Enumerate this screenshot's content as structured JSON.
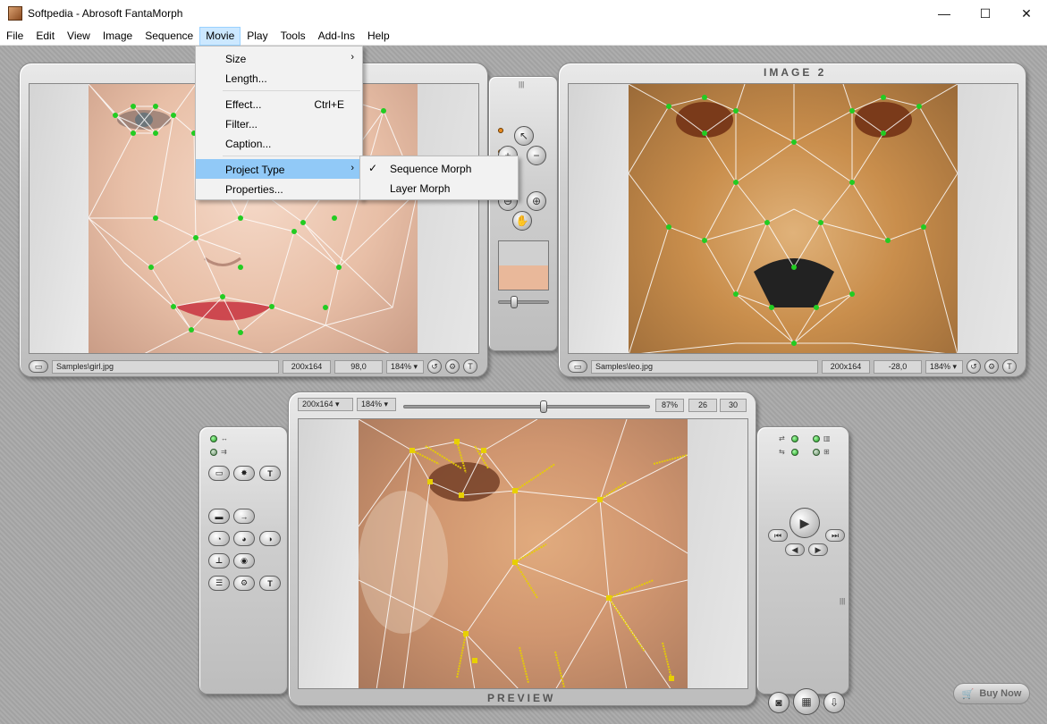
{
  "window": {
    "title": "Softpedia - Abrosoft FantaMorph",
    "controls": {
      "minimize": "—",
      "maximize": "☐",
      "close": "✕"
    }
  },
  "menubar": [
    "File",
    "Edit",
    "View",
    "Image",
    "Sequence",
    "Movie",
    "Play",
    "Tools",
    "Add-Ins",
    "Help"
  ],
  "movie_menu": {
    "size": "Size",
    "length": "Length...",
    "effect": "Effect...",
    "effect_shortcut": "Ctrl+E",
    "filter": "Filter...",
    "caption": "Caption...",
    "project_type": "Project Type",
    "properties": "Properties..."
  },
  "project_type_submenu": {
    "sequence_morph": "Sequence Morph",
    "layer_morph": "Layer Morph",
    "checked": "Sequence Morph"
  },
  "image1": {
    "path": "Samples\\girl.jpg",
    "size": "200x164",
    "value": "98,0",
    "zoom": "184%"
  },
  "image2": {
    "label": "IMAGE 2",
    "path": "Samples\\leo.jpg",
    "size": "200x164",
    "value": "-28,0",
    "zoom": "184%"
  },
  "preview": {
    "label": "PREVIEW",
    "size": "200x164",
    "zoom": "184%",
    "percent": "87%",
    "frame": "26",
    "total": "30",
    "slider_position": 0.57
  },
  "buy_now": "Buy Now",
  "colors": {
    "accent_menu": "#cce8ff",
    "highlight": "#91c9f7",
    "mesh_point": "#22cc22",
    "preview_point": "#e8d000"
  }
}
